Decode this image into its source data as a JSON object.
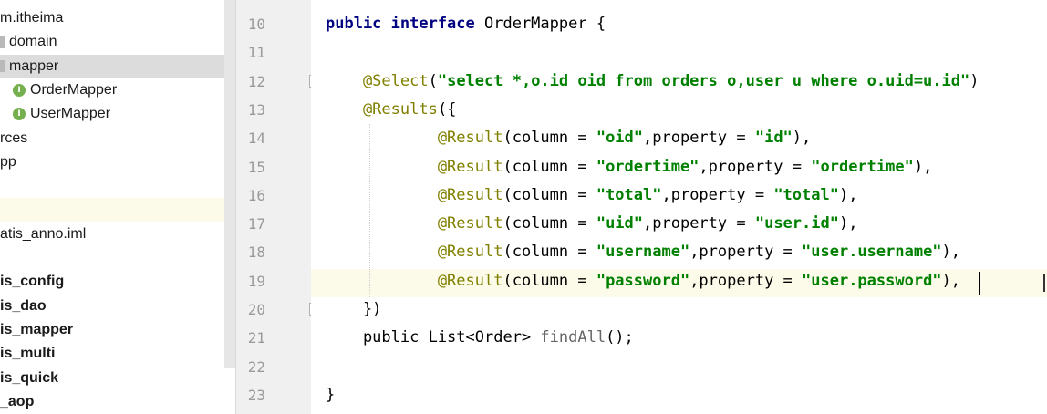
{
  "project_tree": {
    "items": [
      {
        "label": "m.itheima",
        "icon": "none",
        "style": "normal"
      },
      {
        "label": "domain",
        "icon": "folder",
        "style": "normal"
      },
      {
        "label": "mapper",
        "icon": "folder",
        "style": "selected"
      },
      {
        "label": "OrderMapper",
        "icon": "interface",
        "style": "normal"
      },
      {
        "label": "UserMapper",
        "icon": "interface",
        "style": "normal"
      },
      {
        "label": "rces",
        "icon": "none",
        "style": "normal"
      },
      {
        "label": "pp",
        "icon": "none",
        "style": "normal"
      },
      {
        "label": "",
        "icon": "none",
        "style": "normal"
      },
      {
        "label": "",
        "icon": "none",
        "style": "highlight"
      },
      {
        "label": "atis_anno.iml",
        "icon": "none",
        "style": "normal"
      },
      {
        "label": "",
        "icon": "none",
        "style": "normal"
      },
      {
        "label": "is_config",
        "icon": "none",
        "style": "bold"
      },
      {
        "label": "is_dao",
        "icon": "none",
        "style": "bold"
      },
      {
        "label": "is_mapper",
        "icon": "none",
        "style": "bold"
      },
      {
        "label": "is_multi",
        "icon": "none",
        "style": "bold"
      },
      {
        "label": "is_quick",
        "icon": "none",
        "style": "bold"
      },
      {
        "label": "_aop",
        "icon": "none",
        "style": "bold"
      }
    ],
    "interface_icon_letter": "I"
  },
  "editor": {
    "current_line": "19",
    "lines": [
      {
        "num": "10",
        "segments": [
          {
            "t": "public interface",
            "c": "kw"
          },
          {
            "t": " OrderMapper {",
            "c": "plain"
          }
        ]
      },
      {
        "num": "11",
        "segments": []
      },
      {
        "num": "12",
        "segments": [
          {
            "t": "    @Select",
            "c": "ann"
          },
          {
            "t": "(",
            "c": "plain"
          },
          {
            "t": "\"select *,o.id oid from orders o,user u where o.uid=u.id\"",
            "c": "str"
          },
          {
            "t": ")",
            "c": "plain"
          }
        ]
      },
      {
        "num": "13",
        "segments": [
          {
            "t": "    @Results",
            "c": "ann"
          },
          {
            "t": "({",
            "c": "plain"
          }
        ]
      },
      {
        "num": "14",
        "segments": [
          {
            "t": "            @Result",
            "c": "ann"
          },
          {
            "t": "(column = ",
            "c": "plain"
          },
          {
            "t": "\"oid\"",
            "c": "str"
          },
          {
            "t": ",property = ",
            "c": "plain"
          },
          {
            "t": "\"id\"",
            "c": "str"
          },
          {
            "t": "),",
            "c": "plain"
          }
        ]
      },
      {
        "num": "15",
        "segments": [
          {
            "t": "            @Result",
            "c": "ann"
          },
          {
            "t": "(column = ",
            "c": "plain"
          },
          {
            "t": "\"ordertime\"",
            "c": "str"
          },
          {
            "t": ",property = ",
            "c": "plain"
          },
          {
            "t": "\"ordertime\"",
            "c": "str"
          },
          {
            "t": "),",
            "c": "plain"
          }
        ]
      },
      {
        "num": "16",
        "segments": [
          {
            "t": "            @Result",
            "c": "ann"
          },
          {
            "t": "(column = ",
            "c": "plain"
          },
          {
            "t": "\"total\"",
            "c": "str"
          },
          {
            "t": ",property = ",
            "c": "plain"
          },
          {
            "t": "\"total\"",
            "c": "str"
          },
          {
            "t": "),",
            "c": "plain"
          }
        ]
      },
      {
        "num": "17",
        "segments": [
          {
            "t": "            @Result",
            "c": "ann"
          },
          {
            "t": "(column = ",
            "c": "plain"
          },
          {
            "t": "\"uid\"",
            "c": "str"
          },
          {
            "t": ",property = ",
            "c": "plain"
          },
          {
            "t": "\"user.id\"",
            "c": "str"
          },
          {
            "t": "),",
            "c": "plain"
          }
        ]
      },
      {
        "num": "18",
        "segments": [
          {
            "t": "            @Result",
            "c": "ann"
          },
          {
            "t": "(column = ",
            "c": "plain"
          },
          {
            "t": "\"username\"",
            "c": "str"
          },
          {
            "t": ",property = ",
            "c": "plain"
          },
          {
            "t": "\"user.username\"",
            "c": "str"
          },
          {
            "t": "),",
            "c": "plain"
          }
        ]
      },
      {
        "num": "19",
        "segments": [
          {
            "t": "            @Result",
            "c": "ann"
          },
          {
            "t": "(column = ",
            "c": "plain"
          },
          {
            "t": "\"password\"",
            "c": "str"
          },
          {
            "t": ",property = ",
            "c": "plain"
          },
          {
            "t": "\"user.password\"",
            "c": "str"
          },
          {
            "t": "),",
            "c": "plain"
          }
        ]
      },
      {
        "num": "20",
        "segments": [
          {
            "t": "    })",
            "c": "plain"
          }
        ]
      },
      {
        "num": "21",
        "segments": [
          {
            "t": "    public List<Order> ",
            "c": "plain"
          },
          {
            "t": "findAll",
            "c": "method"
          },
          {
            "t": "();",
            "c": "plain"
          }
        ]
      },
      {
        "num": "22",
        "segments": []
      },
      {
        "num": "23",
        "segments": [
          {
            "t": "}",
            "c": "plain"
          }
        ]
      }
    ]
  },
  "colors": {
    "keyword": "#000080",
    "annotation": "#808000",
    "string": "#008000",
    "current_line_bg": "#fcfbe9",
    "selection_bg": "#dcdcdc"
  }
}
